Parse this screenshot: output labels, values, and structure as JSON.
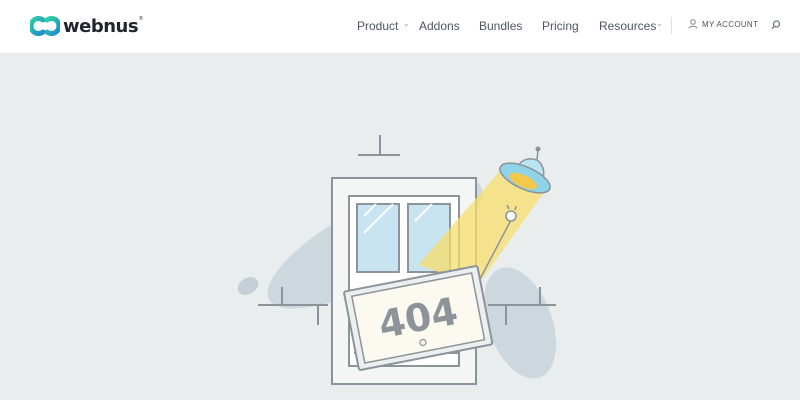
{
  "brand": {
    "name": "webnus",
    "accent_colors": [
      "#2fc6a8",
      "#1e88d4"
    ]
  },
  "nav": {
    "items": [
      {
        "label": "Product",
        "has_dropdown": true
      },
      {
        "label": "Addons",
        "has_dropdown": false
      },
      {
        "label": "Bundles",
        "has_dropdown": false
      },
      {
        "label": "Pricing",
        "has_dropdown": false
      },
      {
        "label": "Resources",
        "has_dropdown": true
      }
    ],
    "account_label": "MY ACCOUNT",
    "account_icon": "user-icon",
    "search_icon": "search-icon"
  },
  "error_illustration": {
    "code": "404",
    "icons": [
      "ufo-icon",
      "window-icon",
      "plug-icon"
    ],
    "colors": {
      "background": "#e9edee",
      "blob": "#c9d5dc",
      "beam": "#f7dd6b",
      "ufo": "#8fd3e8",
      "frame": "#8c9399"
    }
  }
}
